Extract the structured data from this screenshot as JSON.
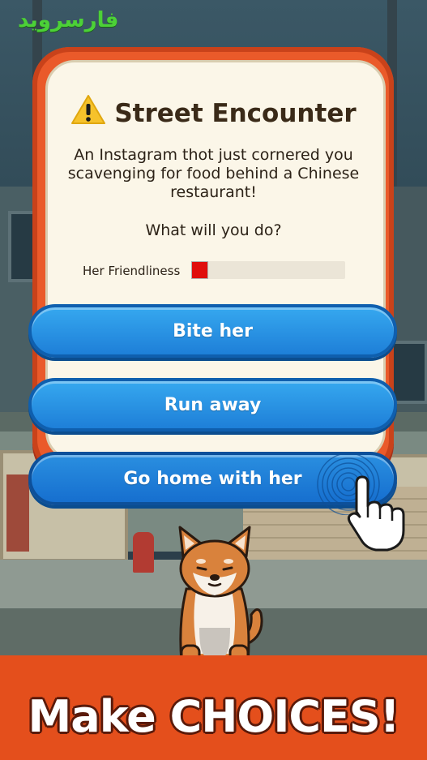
{
  "watermark": "فارسروید",
  "card": {
    "title": "Street Encounter",
    "title_icon": "warning-icon",
    "description": "An Instagram thot just cornered you scavenging for food behind a Chinese restaurant!",
    "question": "What will you do?",
    "meter": {
      "label": "Her Friendliness",
      "level": 0.11,
      "color": "#e00d0d"
    }
  },
  "choices": [
    {
      "label": "Bite her"
    },
    {
      "label": "Run away"
    },
    {
      "label": "Go home with her"
    }
  ],
  "banner": {
    "text": "Make CHOICES!"
  },
  "colors": {
    "card_frame": "#ea5a2a",
    "card_bg": "#fbf6e8",
    "button": "#2a8fe0",
    "banner": "#e44f1c",
    "watermark": "#4cd137"
  },
  "icons": [
    "warning-icon",
    "hand-pointer-icon",
    "tap-ripple-icon",
    "shiba-dog-icon"
  ]
}
